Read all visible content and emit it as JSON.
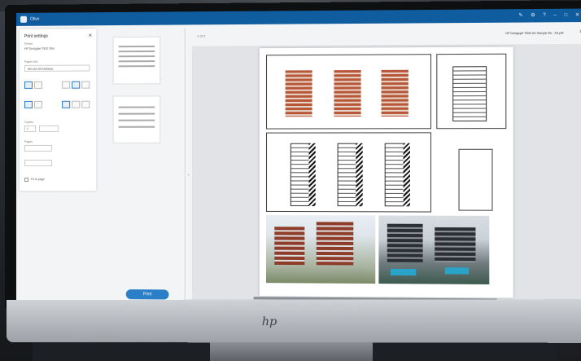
{
  "app": {
    "title": "Olive"
  },
  "window_controls": {
    "edit": "✎",
    "settings": "⚙",
    "help": "?",
    "minimize": "–",
    "maximize": "□",
    "close": "✕"
  },
  "print_settings": {
    "title": "Print settings",
    "close": "✕",
    "printer_label": "Printer",
    "printer_value": "HP Designjet T830 36in",
    "paper_label": "Paper size",
    "paper_value": "ISO A3 297x420mm",
    "copies_label": "Copies",
    "copies_value": "1",
    "pages_label": "Pages",
    "fit_label": "Fit to page",
    "print_button": "Print"
  },
  "preview": {
    "page_info": "1 of 2",
    "filename": "HP Designjet T830 A3 Sample file - A3.pdf",
    "next_arrow": "›",
    "prev_arrow": "‹"
  },
  "monitor": {
    "brand_logo": "hp"
  },
  "colors": {
    "titlebar": "#0f5c9e",
    "accent": "#2a7fc6",
    "facade_red": "#b8563a"
  },
  "icons": [
    "app-icon",
    "close-icon",
    "pan-icon",
    "zoom-in-icon",
    "zoom-out-icon",
    "chevron-right-icon"
  ]
}
